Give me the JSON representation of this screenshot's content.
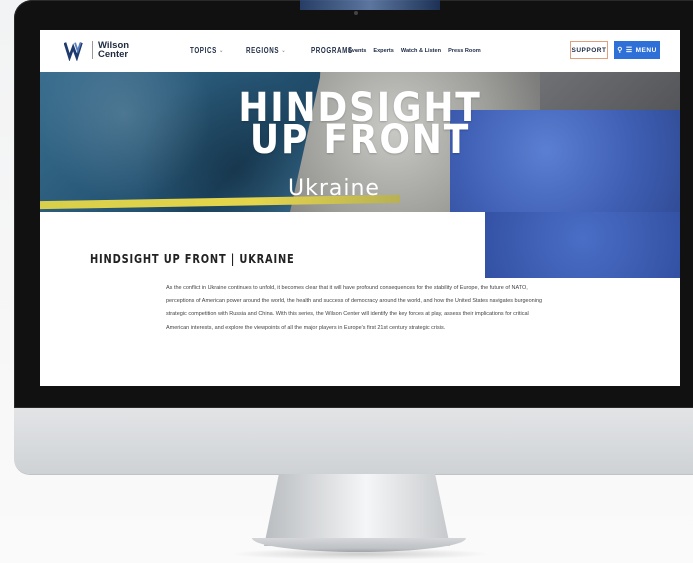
{
  "site": {
    "logo_line1": "Wilson",
    "logo_line2": "Center"
  },
  "nav": {
    "main": [
      {
        "label": "TOPICS"
      },
      {
        "label": "REGIONS"
      },
      {
        "label": "PROGRAMS"
      }
    ],
    "secondary": [
      {
        "label": "Events"
      },
      {
        "label": "Experts"
      },
      {
        "label": "Watch & Listen"
      },
      {
        "label": "Press Room"
      }
    ],
    "support_label": "SUPPORT",
    "menu_label": "MENU"
  },
  "hero": {
    "title_line1": "HINDSIGHT",
    "title_line2": "UP FRONT",
    "subtitle": "Ukraine"
  },
  "page": {
    "heading": "HINDSIGHT UP FRONT | UKRAINE",
    "intro": "As the conflict in Ukraine continues to unfold, it becomes clear that it will have profound consequences for the stability of Europe, the future of NATO, perceptions of American power around the world, the health and success of democracy around the world, and how the United States navigates burgeoning strategic competition with Russia and China. With this series, the Wilson Center will identify the key forces at play, assess their implications for critical American interests, and explore the viewpoints of all the major players in Europe's first 21st century strategic crisis."
  },
  "colors": {
    "menu_button": "#2e6fd8",
    "support_border": "#e2a07a",
    "hero_yellow": "#e4d54b",
    "hero_blue": "#3f5fb4"
  },
  "icons": {
    "search": "search-icon",
    "menu": "hamburger-icon",
    "chevron": "chevron-down-icon"
  }
}
